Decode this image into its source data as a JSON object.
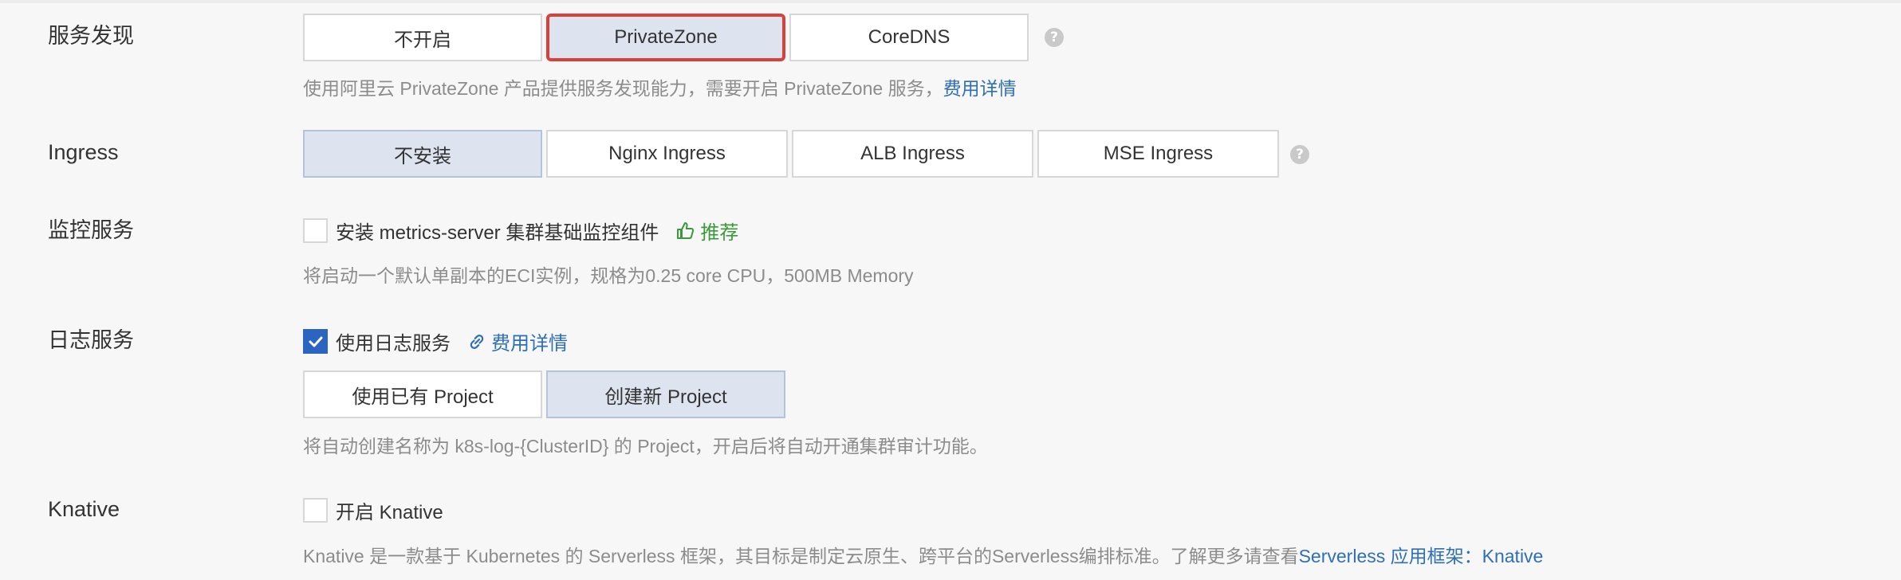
{
  "service_discovery": {
    "label": "服务发现",
    "options": [
      "不开启",
      "PrivateZone",
      "CoreDNS"
    ],
    "selected": "PrivateZone",
    "help_icon": "?",
    "description": "使用阿里云 PrivateZone 产品提供服务发现能力，需要开启 PrivateZone 服务，",
    "link_text": "费用详情"
  },
  "ingress": {
    "label": "Ingress",
    "options": [
      "不安装",
      "Nginx Ingress",
      "ALB Ingress",
      "MSE Ingress"
    ],
    "selected": "不安装",
    "help_icon": "?"
  },
  "monitoring": {
    "label": "监控服务",
    "checkbox_label": "安装 metrics-server 集群基础监控组件",
    "checked": false,
    "recommend_label": "推荐",
    "recommend_icon": "thumbs-up-icon",
    "description": "将启动一个默认单副本的ECI实例，规格为0.25 core CPU，500MB Memory"
  },
  "logging": {
    "label": "日志服务",
    "checkbox_label": "使用日志服务",
    "checked": true,
    "link_icon": "link-icon",
    "link_text": "费用详情",
    "options": [
      "使用已有 Project",
      "创建新 Project"
    ],
    "selected": "创建新 Project",
    "description": "将自动创建名称为 k8s-log-{ClusterID} 的 Project，开启后将自动开通集群审计功能。"
  },
  "knative": {
    "label": "Knative",
    "checkbox_label": "开启 Knative",
    "checked": false,
    "description": "Knative 是一款基于 Kubernetes 的 Serverless 框架，其目标是制定云原生、跨平台的Serverless编排标准。了解更多请查看",
    "link_text": "Serverless 应用框架：Knative"
  },
  "colors": {
    "selected_bg": "#dde4f0",
    "highlight_border": "#d9403a",
    "link": "#2f6fb6",
    "recommend": "#3a9a3a",
    "checkbox_checked": "#2b64c1"
  }
}
